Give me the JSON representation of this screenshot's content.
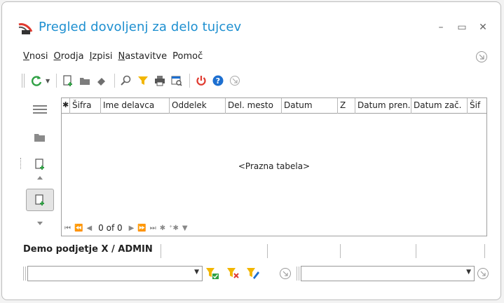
{
  "window": {
    "title": "Pregled dovoljenj za delo tujcev",
    "controls": {
      "minimize": "–",
      "maximize": "▭",
      "close": "✕"
    }
  },
  "menu": {
    "items": [
      {
        "accel": "V",
        "rest": "nosi"
      },
      {
        "accel": "O",
        "rest": "rodja"
      },
      {
        "accel": "I",
        "rest": "zpisi"
      },
      {
        "accel": "N",
        "rest": "astavitve"
      },
      {
        "accel": "",
        "rest": "Pomoč"
      }
    ]
  },
  "toolbar": {
    "icons": [
      "refresh-icon",
      "new-document-icon",
      "folder-icon",
      "eraser-icon",
      "search-icon",
      "filter-icon",
      "print-icon",
      "report-icon",
      "power-icon",
      "help-icon",
      "collapse-icon"
    ]
  },
  "grid": {
    "columns": [
      "Šifra",
      "Ime delavca",
      "Oddelek",
      "Del. mesto",
      "Datum",
      "Z",
      "Datum pren.",
      "Datum zač.",
      "Šif"
    ],
    "empty_text": "<Prazna tabela>",
    "navigator": {
      "position": "0 of 0"
    }
  },
  "status": {
    "company_user": "Demo podjetje X / ADMIN"
  },
  "colors": {
    "title": "#1d8fd0",
    "refresh": "#2ea043",
    "filter": "#f2b600",
    "power": "#e03a2f",
    "help": "#1d6fd0"
  }
}
